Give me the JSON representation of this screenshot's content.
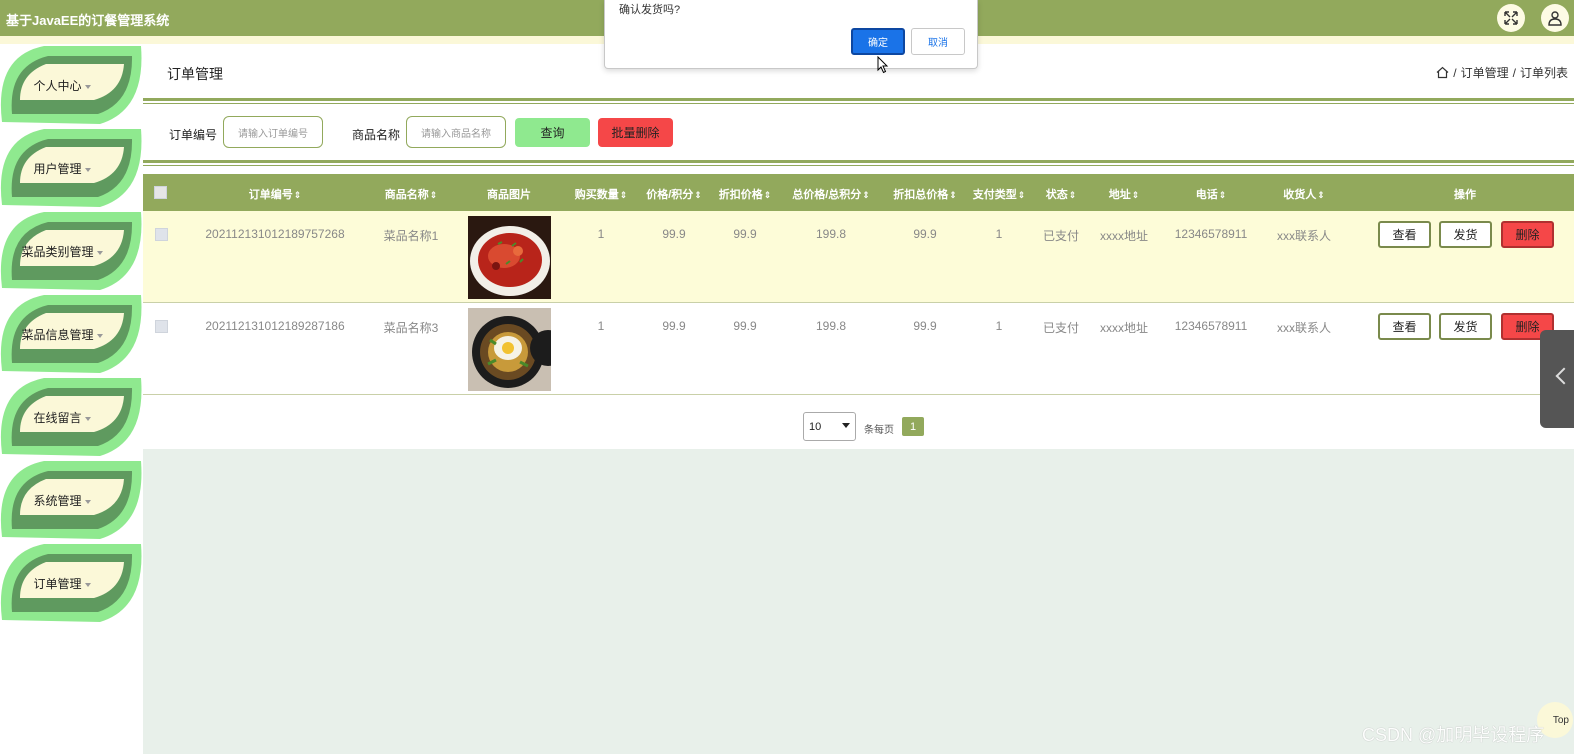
{
  "app": {
    "title": "基于JavaEE的订餐管理系统"
  },
  "topbar_icons": [
    "fullscreen-icon",
    "user-icon"
  ],
  "sidebar": {
    "items": [
      {
        "label": "个人中心"
      },
      {
        "label": "用户管理"
      },
      {
        "label": "菜品类别管理"
      },
      {
        "label": "菜品信息管理"
      },
      {
        "label": "在线留言"
      },
      {
        "label": "系统管理"
      },
      {
        "label": "订单管理"
      }
    ]
  },
  "page": {
    "title": "订单管理"
  },
  "breadcrumb": {
    "sep": "/",
    "items": [
      "订单管理",
      "订单列表"
    ]
  },
  "filters": {
    "order_no": {
      "label": "订单编号",
      "placeholder": "请输入订单编号"
    },
    "goods_name": {
      "label": "商品名称",
      "placeholder": "请输入商品名称"
    },
    "search_label": "查询",
    "batch_delete_label": "批量删除"
  },
  "table": {
    "columns": [
      "订单编号",
      "商品名称",
      "商品图片",
      "购买数量",
      "价格/积分",
      "折扣价格",
      "总价格/总积分",
      "折扣总价格",
      "支付类型",
      "状态",
      "地址",
      "电话",
      "收货人",
      "操作"
    ],
    "sort_glyph": "⇕",
    "rows": [
      {
        "order_no": "202112131012189757268",
        "goods_name": "菜品名称1",
        "qty": "1",
        "price": "99.9",
        "discount_price": "99.9",
        "total": "199.8",
        "discount_total": "99.9",
        "pay_type": "1",
        "status": "已支付",
        "address": "xxxx地址",
        "phone": "12346578911",
        "receiver": "xxx联系人"
      },
      {
        "order_no": "202112131012189287186",
        "goods_name": "菜品名称3",
        "qty": "1",
        "price": "99.9",
        "discount_price": "99.9",
        "total": "199.8",
        "discount_total": "99.9",
        "pay_type": "1",
        "status": "已支付",
        "address": "xxxx地址",
        "phone": "12346578911",
        "receiver": "xxx联系人"
      }
    ],
    "actions": {
      "view": "查看",
      "ship": "发货",
      "delete": "删除"
    }
  },
  "pagination": {
    "page_size": "10",
    "per_page_label": "条每页",
    "current_page": "1"
  },
  "dialog": {
    "message": "确认发货吗?",
    "confirm_label": "确定",
    "cancel_label": "取消"
  },
  "floating": {
    "top_label": "Top"
  },
  "watermark": "CSDN @加明毕设程序",
  "colors": {
    "header": "#92a95c",
    "leaf_light": "#8fe98f",
    "leaf_dark": "#5f9a5f",
    "row_highlight": "#fdfcd8",
    "delete": "#f54748",
    "confirm": "#1a73e8"
  }
}
